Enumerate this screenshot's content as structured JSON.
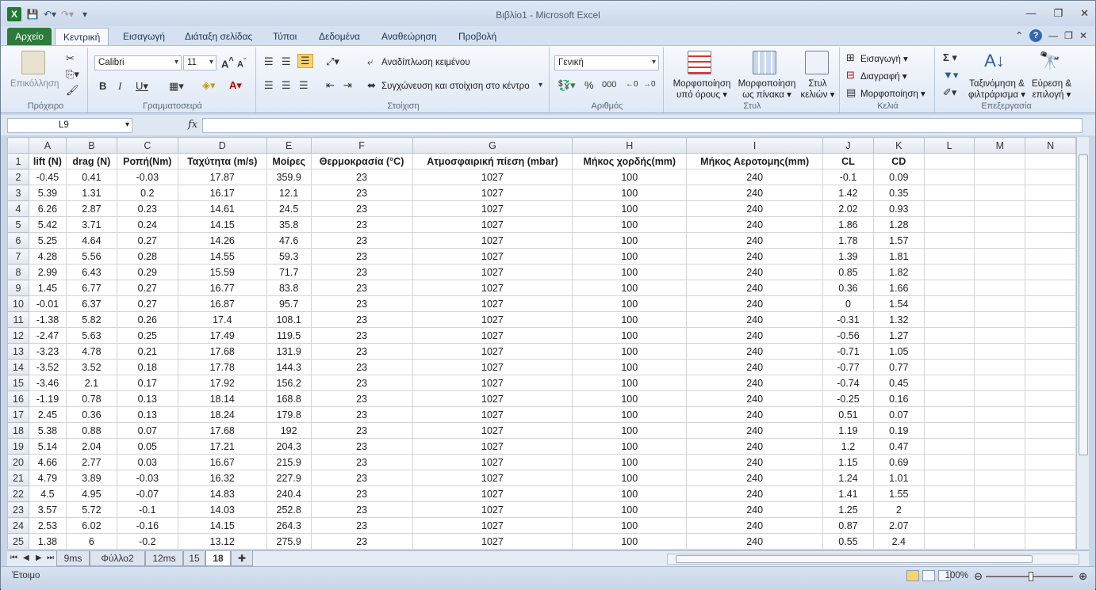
{
  "window": {
    "title": "Βιβλίο1  -  Microsoft Excel"
  },
  "tabs": [
    "Αρχείο",
    "Κεντρική",
    "Εισαγωγή",
    "Διάταξη σελίδας",
    "Τύποι",
    "Δεδομένα",
    "Αναθεώρηση",
    "Προβολή"
  ],
  "ribbon": {
    "clipboard": {
      "paste": "Επικόλληση",
      "label": "Πρόχειρο"
    },
    "font": {
      "name": "Calibri",
      "size": "11",
      "label": "Γραμματοσειρά"
    },
    "alignment": {
      "wrap": "Αναδίπλωση κειμένου",
      "merge": "Συγχώνευση και στοίχιση στο κέντρο",
      "label": "Στοίχιση"
    },
    "number": {
      "format": "Γενική",
      "label": "Αριθμός"
    },
    "styles": {
      "cond1": "Μορφοποίηση",
      "cond2": "υπό όρους",
      "table1": "Μορφοποίηση",
      "table2": "ως πίνακα",
      "cell1": "Στυλ",
      "cell2": "κελιών",
      "label": "Στυλ"
    },
    "cells": {
      "insert": "Εισαγωγή",
      "delete": "Διαγραφή",
      "format": "Μορφοποίηση",
      "label": "Κελιά"
    },
    "editing": {
      "sort1": "Ταξινόμηση &",
      "sort2": "φιλτράρισμα",
      "find1": "Εύρεση &",
      "find2": "επιλογή",
      "label": "Επεξεργασία"
    }
  },
  "formula_bar": {
    "name_box": "L9",
    "fx": "fx",
    "value": ""
  },
  "columns": [
    "A",
    "B",
    "C",
    "D",
    "E",
    "F",
    "G",
    "H",
    "I",
    "J",
    "K",
    "L",
    "M",
    "N"
  ],
  "header_row": [
    "lift (N)",
    "drag (N)",
    "Ροπή(Nm)",
    "Ταχύτητα (m/s)",
    "Μοίρες",
    "Θερμοκρασία (°C)",
    "Ατμοσφαιρική πίεση (mbar)",
    "Μήκος χορδής(mm)",
    "Μήκος Αεροτομης(mm)",
    "CL",
    "CD",
    "",
    "",
    ""
  ],
  "rows": [
    [
      "-0.45",
      "0.41",
      "-0.03",
      "17.87",
      "359.9",
      "23",
      "1027",
      "100",
      "240",
      "-0.1",
      "0.09"
    ],
    [
      "5.39",
      "1.31",
      "0.2",
      "16.17",
      "12.1",
      "23",
      "1027",
      "100",
      "240",
      "1.42",
      "0.35"
    ],
    [
      "6.26",
      "2.87",
      "0.23",
      "14.61",
      "24.5",
      "23",
      "1027",
      "100",
      "240",
      "2.02",
      "0.93"
    ],
    [
      "5.42",
      "3.71",
      "0.24",
      "14.15",
      "35.8",
      "23",
      "1027",
      "100",
      "240",
      "1.86",
      "1.28"
    ],
    [
      "5.25",
      "4.64",
      "0.27",
      "14.26",
      "47.6",
      "23",
      "1027",
      "100",
      "240",
      "1.78",
      "1.57"
    ],
    [
      "4.28",
      "5.56",
      "0.28",
      "14.55",
      "59.3",
      "23",
      "1027",
      "100",
      "240",
      "1.39",
      "1.81"
    ],
    [
      "2.99",
      "6.43",
      "0.29",
      "15.59",
      "71.7",
      "23",
      "1027",
      "100",
      "240",
      "0.85",
      "1.82"
    ],
    [
      "1.45",
      "6.77",
      "0.27",
      "16.77",
      "83.8",
      "23",
      "1027",
      "100",
      "240",
      "0.36",
      "1.66"
    ],
    [
      "-0.01",
      "6.37",
      "0.27",
      "16.87",
      "95.7",
      "23",
      "1027",
      "100",
      "240",
      "0",
      "1.54"
    ],
    [
      "-1.38",
      "5.82",
      "0.26",
      "17.4",
      "108.1",
      "23",
      "1027",
      "100",
      "240",
      "-0.31",
      "1.32"
    ],
    [
      "-2.47",
      "5.63",
      "0.25",
      "17.49",
      "119.5",
      "23",
      "1027",
      "100",
      "240",
      "-0.56",
      "1.27"
    ],
    [
      "-3.23",
      "4.78",
      "0.21",
      "17.68",
      "131.9",
      "23",
      "1027",
      "100",
      "240",
      "-0.71",
      "1.05"
    ],
    [
      "-3.52",
      "3.52",
      "0.18",
      "17.78",
      "144.3",
      "23",
      "1027",
      "100",
      "240",
      "-0.77",
      "0.77"
    ],
    [
      "-3.46",
      "2.1",
      "0.17",
      "17.92",
      "156.2",
      "23",
      "1027",
      "100",
      "240",
      "-0.74",
      "0.45"
    ],
    [
      "-1.19",
      "0.78",
      "0.13",
      "18.14",
      "168.8",
      "23",
      "1027",
      "100",
      "240",
      "-0.25",
      "0.16"
    ],
    [
      "2.45",
      "0.36",
      "0.13",
      "18.24",
      "179.8",
      "23",
      "1027",
      "100",
      "240",
      "0.51",
      "0.07"
    ],
    [
      "5.38",
      "0.88",
      "0.07",
      "17.68",
      "192",
      "23",
      "1027",
      "100",
      "240",
      "1.19",
      "0.19"
    ],
    [
      "5.14",
      "2.04",
      "0.05",
      "17.21",
      "204.3",
      "23",
      "1027",
      "100",
      "240",
      "1.2",
      "0.47"
    ],
    [
      "4.66",
      "2.77",
      "0.03",
      "16.67",
      "215.9",
      "23",
      "1027",
      "100",
      "240",
      "1.15",
      "0.69"
    ],
    [
      "4.79",
      "3.89",
      "-0.03",
      "16.32",
      "227.9",
      "23",
      "1027",
      "100",
      "240",
      "1.24",
      "1.01"
    ],
    [
      "4.5",
      "4.95",
      "-0.07",
      "14.83",
      "240.4",
      "23",
      "1027",
      "100",
      "240",
      "1.41",
      "1.55"
    ],
    [
      "3.57",
      "5.72",
      "-0.1",
      "14.03",
      "252.8",
      "23",
      "1027",
      "100",
      "240",
      "1.25",
      "2"
    ],
    [
      "2.53",
      "6.02",
      "-0.16",
      "14.15",
      "264.3",
      "23",
      "1027",
      "100",
      "240",
      "0.87",
      "2.07"
    ],
    [
      "1.38",
      "6",
      "-0.2",
      "13.12",
      "275.9",
      "23",
      "1027",
      "100",
      "240",
      "0.55",
      "2.4"
    ]
  ],
  "sheets": [
    "9ms",
    "Φύλλο2",
    "12ms",
    "15",
    "18"
  ],
  "active_sheet": "18",
  "status": {
    "ready": "Έτοιμο",
    "zoom": "100%"
  }
}
